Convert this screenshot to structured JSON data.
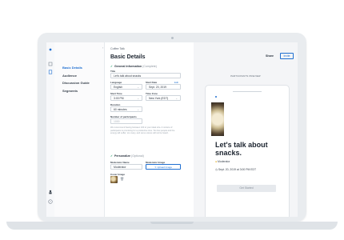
{
  "nav": {
    "items": [
      {
        "label": "Basic Details",
        "active": true
      },
      {
        "label": "Audience"
      },
      {
        "label": "Discussion Guide"
      },
      {
        "label": "Segments"
      }
    ]
  },
  "main": {
    "breadcrumb": "Coffee Talk",
    "title": "Basic Details",
    "general": {
      "heading": "General Information",
      "optional": "(Complete)",
      "title_label": "Title",
      "title_value": "Let's talk about snacks",
      "language_label": "Language",
      "language_value": "English",
      "start_date_label": "Start Date",
      "start_date_value": "Sept. 20, 2019",
      "edit_label": "Edit",
      "start_time_label": "Start Time",
      "start_time_value": "3:00 PM",
      "timezone_label": "Time Zone",
      "timezone_value": "New York (EDT)",
      "duration_label": "Duration",
      "duration_value": "60 minutes",
      "participants_label": "Number of participants",
      "participants_placeholder": "1000",
      "participants_help": "We recommend having between 100 to your ideal size. A mixture of participants is promising for a productive time. Too few people and the energy will suffer; too many, and some voices will not be heard."
    },
    "personalize": {
      "heading": "Personalize",
      "optional": "(Optional)",
      "moderator_label": "Moderator Name",
      "moderator_value": "Moderator",
      "image_label": "Moderator Image",
      "upload_label": "Upload Image",
      "cover_label": "Cover Image"
    }
  },
  "header": {
    "share_label": "Share",
    "invite_label": "Invite"
  },
  "preview": {
    "label": "PARTICIPANTS PREVIEW",
    "title": "Let's talk about snacks.",
    "host": "Moderator",
    "when": "Sept. 20, 2019 at 3:00 PM EDT",
    "cta": "Get Started"
  },
  "colors": {
    "accent": "#1f6fd1",
    "check": "#22a06b"
  }
}
